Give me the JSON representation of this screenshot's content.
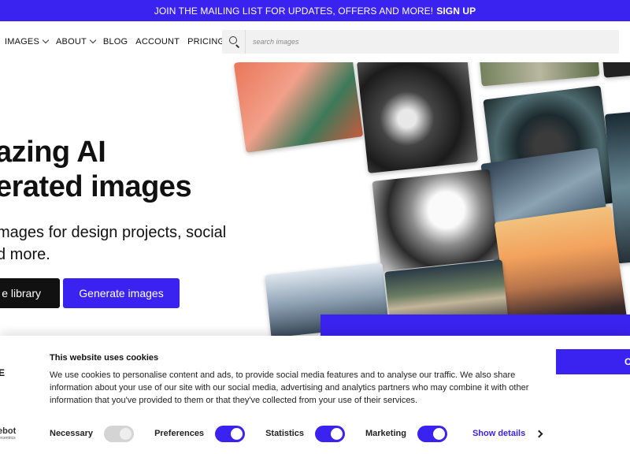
{
  "promo": {
    "text": "JOIN THE MAILING LIST FOR UPDATES, OFFERS AND MORE!",
    "cta": "SIGN UP"
  },
  "nav": {
    "items": [
      {
        "label": "IMAGES",
        "dropdown": true
      },
      {
        "label": "ABOUT",
        "dropdown": true
      },
      {
        "label": "BLOG"
      },
      {
        "label": "ACCOUNT"
      },
      {
        "label": "PRICING"
      }
    ],
    "search_placeholder": "search images"
  },
  "hero": {
    "title_line1": "azing AI",
    "title_line2": "erated images",
    "subtitle_line1": "mages for design projects, social",
    "subtitle_line2": "d more.",
    "btn_library": "e library",
    "btn_generate": "Generate images"
  },
  "cookie": {
    "title": "This website uses cookies",
    "body": "We use cookies to personalise content and ads, to provide social media features and to analyse our traffic. We also share information about your use of our site with our social media, advertising and analytics partners who may combine it with other information that you've provided to them or that they've collected from your use of their services.",
    "edge_letter": "E",
    "brand": "iebot",
    "brand_sub": "ercentrics",
    "ok_label": "O",
    "toggles": [
      {
        "label": "Necessary",
        "state": "on",
        "disabled": true
      },
      {
        "label": "Preferences",
        "state": "on"
      },
      {
        "label": "Statistics",
        "state": "on"
      },
      {
        "label": "Marketing",
        "state": "on"
      }
    ],
    "show_details": "Show details"
  },
  "colors": {
    "accent": "#3a22f0",
    "dark": "#111111"
  }
}
